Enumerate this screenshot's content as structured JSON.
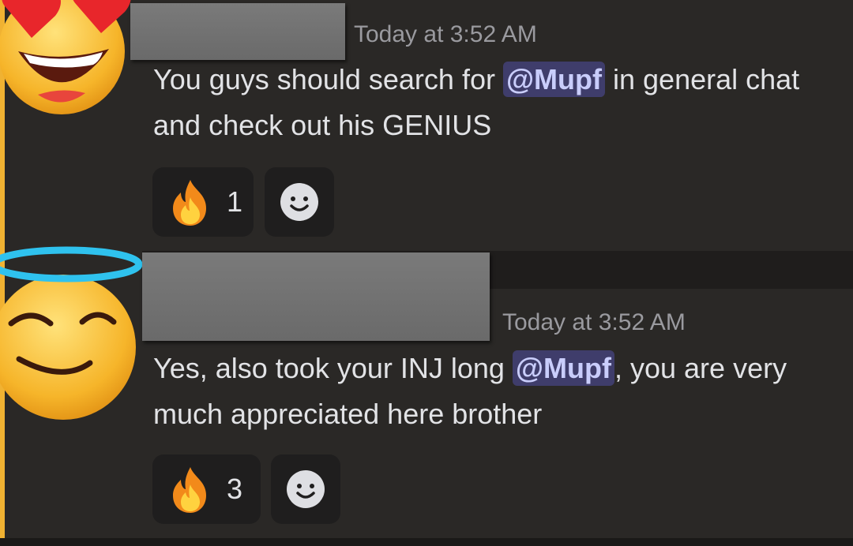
{
  "messages": [
    {
      "timestamp": "Today at 3:52 AM",
      "text_before": "You guys should search for ",
      "mention": "@Mupf",
      "text_after": " in general chat and check out his GENIUS",
      "reaction": {
        "emoji": "fire-emoji",
        "count": "1"
      },
      "avatar_icon": "heart-eyes-emoji"
    },
    {
      "timestamp": "Today at 3:52 AM",
      "text_before": "Yes, also took your INJ long ",
      "mention": "@Mupf",
      "text_after": ", you are very much appreciated here brother",
      "reaction": {
        "emoji": "fire-emoji",
        "count": "3"
      },
      "avatar_icon": "halo-smile-emoji"
    }
  ],
  "colors": {
    "background": "#2a2826",
    "accent_bar": "#f0b232",
    "mention_bg": "#3f3d6b",
    "mention_text": "#c9cdfb",
    "timestamp": "#9a9a9f",
    "text": "#e2e3e6"
  },
  "icons": {
    "add_reaction": "smiley-add-reaction-icon"
  }
}
